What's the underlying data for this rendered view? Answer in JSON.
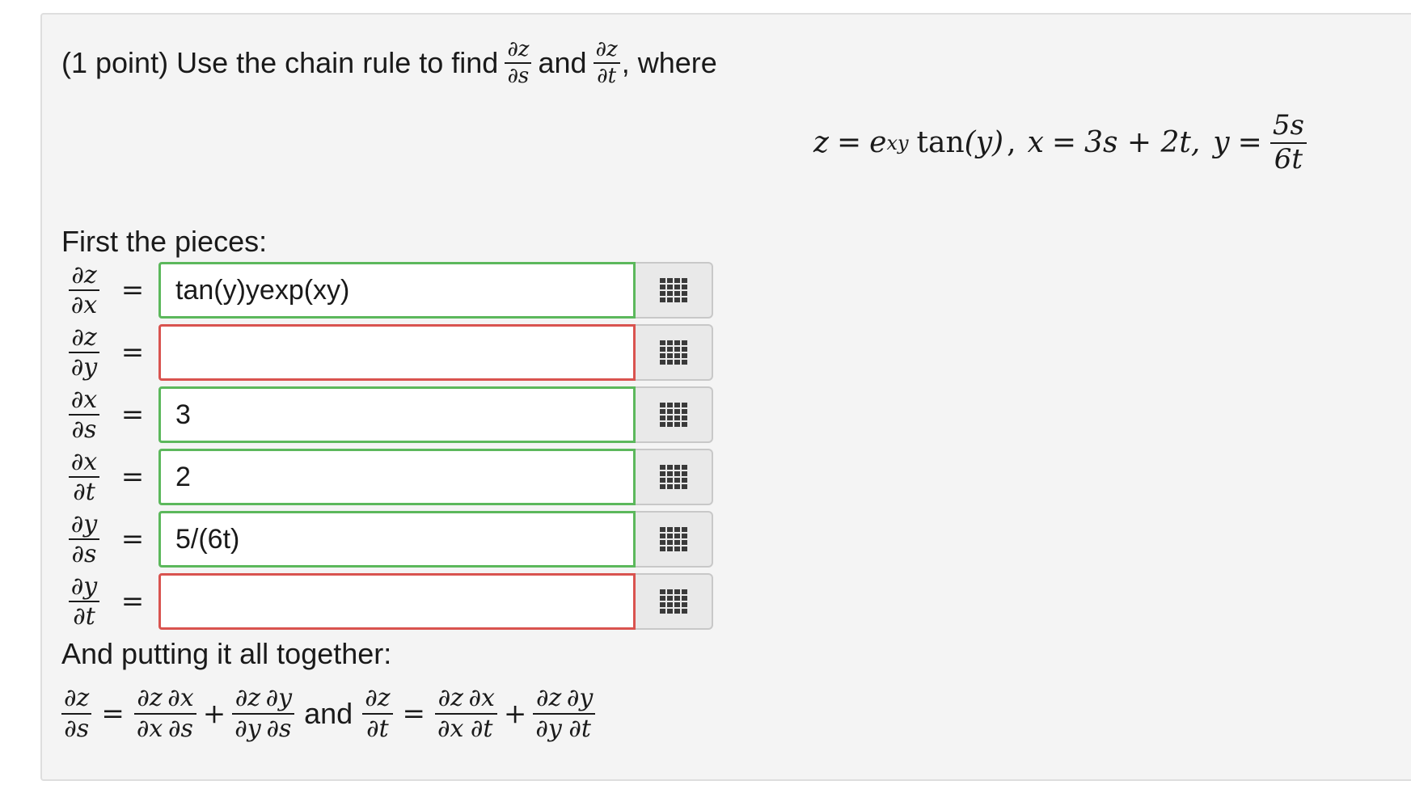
{
  "problem": {
    "prefix": "(1 point) Use the chain rule to find",
    "connector": "and",
    "suffix": ", where"
  },
  "definitions": {
    "z_lhs": "z",
    "z_rhs_base": "e",
    "z_rhs_exp": "xy",
    "z_rhs_func": "tan",
    "z_rhs_arg": "(y)",
    "sep1": ",",
    "x_lhs": "x",
    "x_rhs": "3s + 2t,",
    "y_lhs": "y",
    "y_num": "5s",
    "y_den": "6t"
  },
  "symbols": {
    "equals": "=",
    "plus": "+",
    "partial_z": "∂z",
    "partial_x": "∂x",
    "partial_y": "∂y",
    "partial_s": "∂s",
    "partial_t": "∂t"
  },
  "sections": {
    "first_pieces": "First the pieces:",
    "putting_together": "And putting it all together:",
    "and": "and"
  },
  "pieces": [
    {
      "num": "∂z",
      "den": "∂x",
      "value": "tan(y)yexp(xy)",
      "status": "correct"
    },
    {
      "num": "∂z",
      "den": "∂y",
      "value": "",
      "status": "incorrect"
    },
    {
      "num": "∂x",
      "den": "∂s",
      "value": "3",
      "status": "correct"
    },
    {
      "num": "∂x",
      "den": "∂t",
      "value": "2",
      "status": "correct"
    },
    {
      "num": "∂y",
      "den": "∂s",
      "value": "5/(6t)",
      "status": "correct"
    },
    {
      "num": "∂y",
      "den": "∂t",
      "value": "",
      "status": "incorrect"
    }
  ],
  "colors": {
    "correct_border": "#5cb85c",
    "incorrect_border": "#d9534f",
    "panel_bg": "#f4f4f4"
  },
  "icons": {
    "palette": "grid-icon"
  }
}
